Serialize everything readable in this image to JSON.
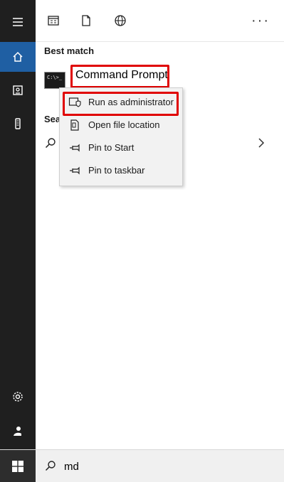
{
  "best_match_label": "Best match",
  "best_match_item": {
    "name": "Command Prompt",
    "icon": "cmd-icon",
    "icon_text": "C:\\>_"
  },
  "search_section_label": "Sea",
  "context_menu": {
    "items": [
      {
        "label": "Run as administrator",
        "icon": "shield-icon"
      },
      {
        "label": "Open file location",
        "icon": "folder-icon"
      },
      {
        "label": "Pin to Start",
        "icon": "pin-icon"
      },
      {
        "label": "Pin to taskbar",
        "icon": "pin-icon"
      }
    ]
  },
  "search": {
    "value": "md"
  },
  "toolbar": {
    "more": "···"
  },
  "colors": {
    "rail": "#1f1f1f",
    "rail_active": "#1f5fa3",
    "highlight": "#e00000",
    "menu_bg": "#f2f2f2"
  }
}
